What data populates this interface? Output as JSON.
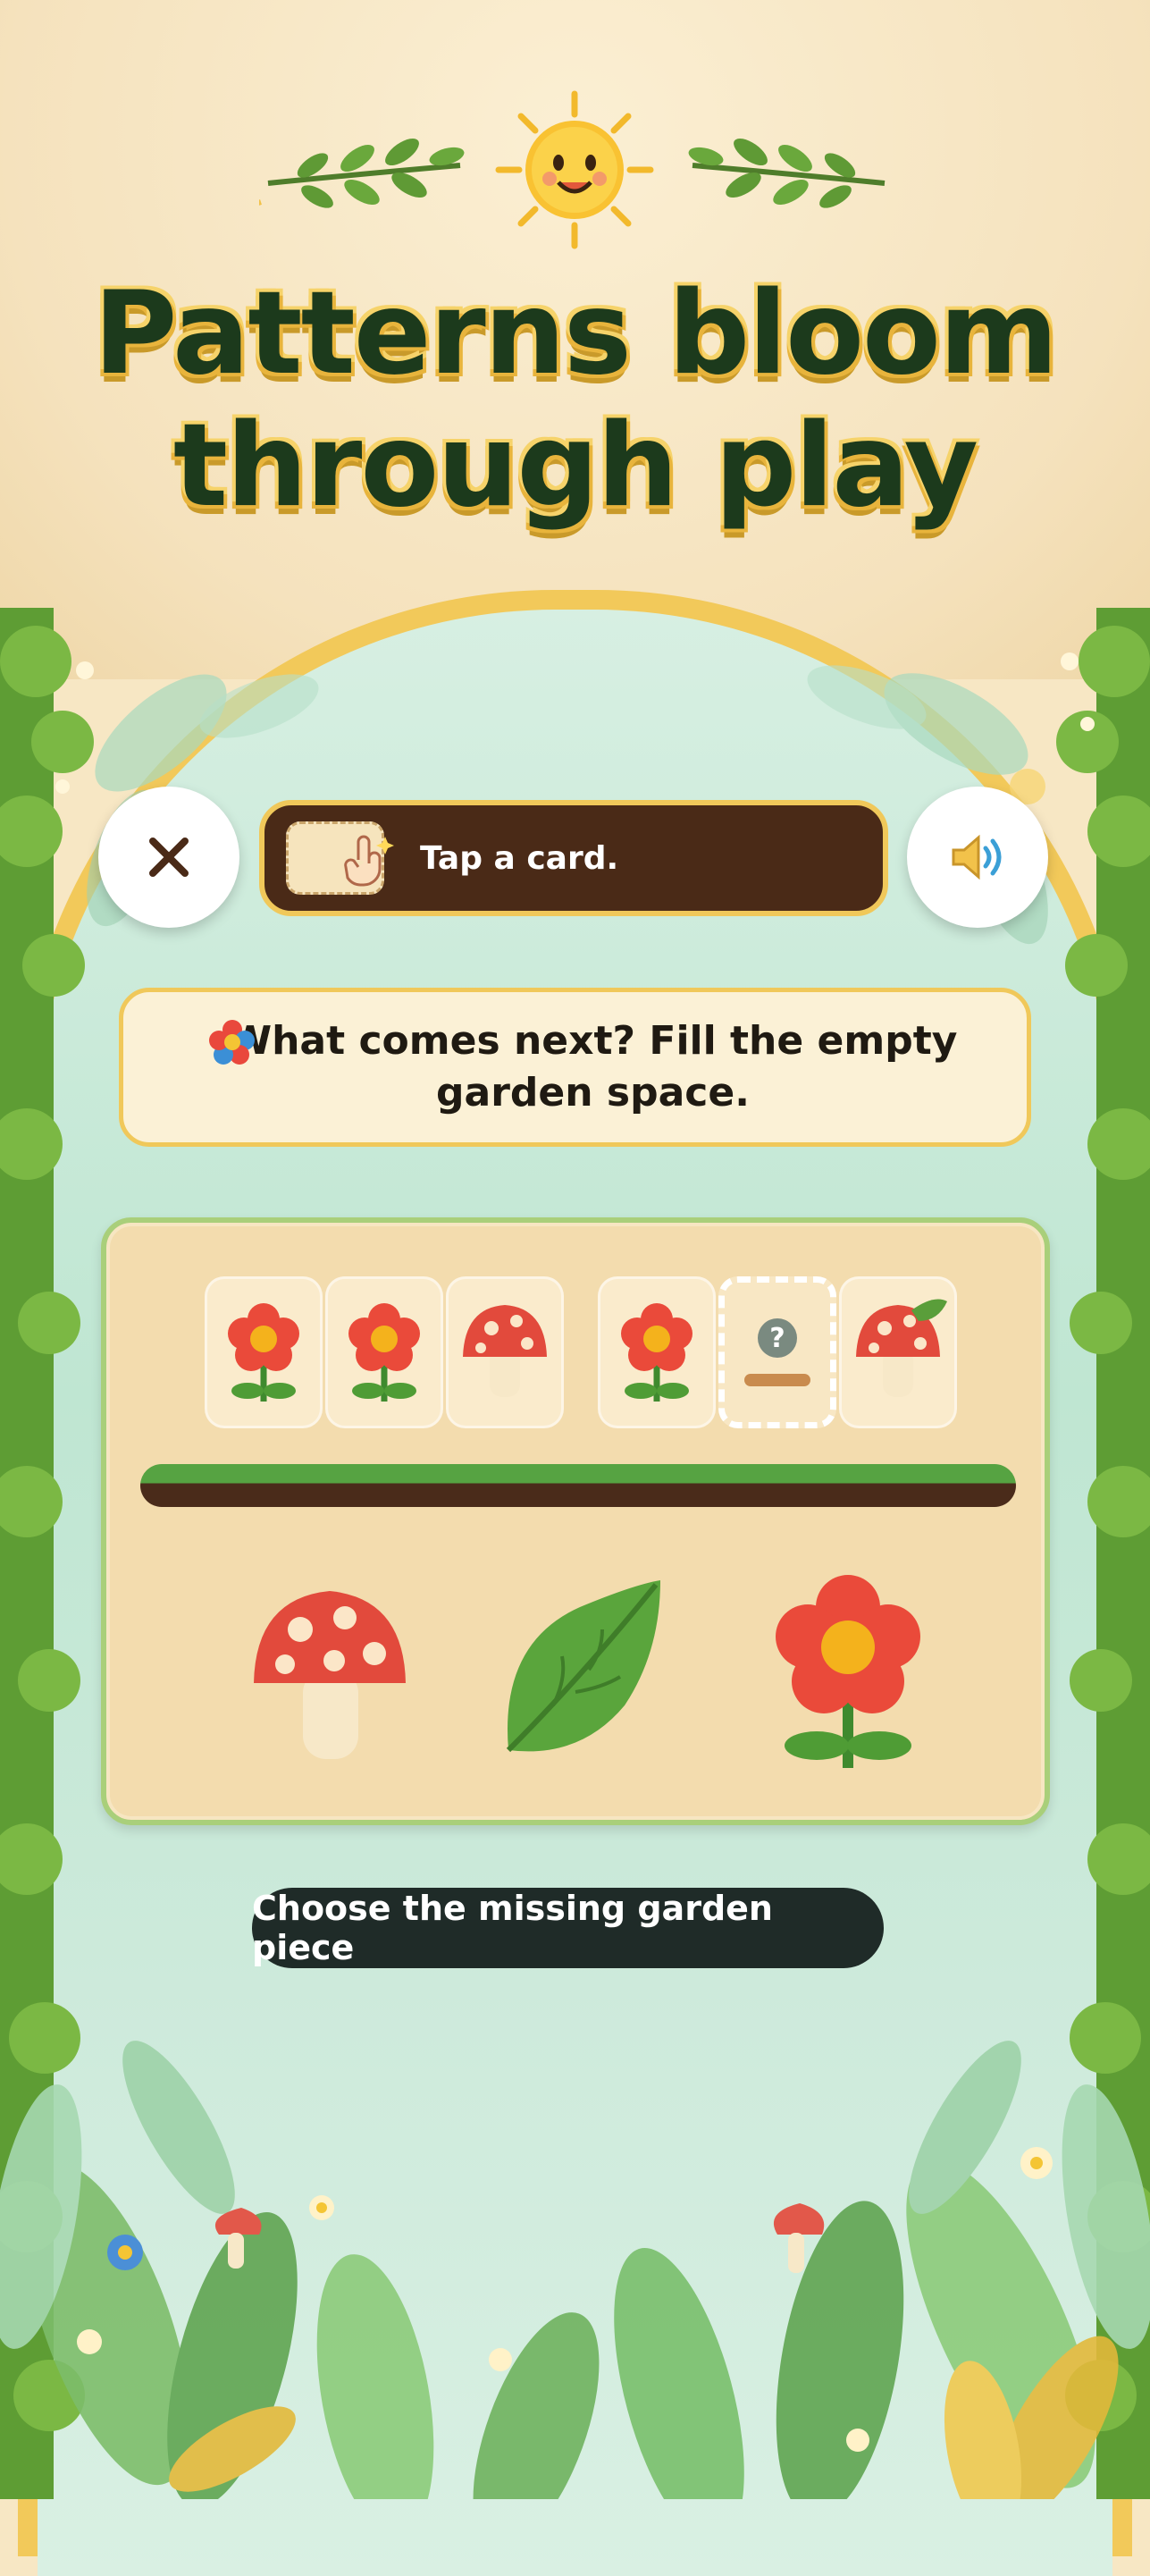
{
  "headline": {
    "line1": "Patterns bloom",
    "line2": "through play"
  },
  "top_bar": {
    "close_icon": "close-x-icon",
    "hint_text": "Tap a card.",
    "hint_icon": "tap-card-icon",
    "sound_icon": "speaker-icon"
  },
  "question": {
    "icon": "flower-icon",
    "text": "What comes next? Fill the empty garden space."
  },
  "pattern": {
    "sequence": [
      "flower",
      "flower",
      "mushroom",
      "flower",
      "empty",
      "mushroom"
    ],
    "empty_symbol": "?"
  },
  "choices": [
    "mushroom",
    "leaf",
    "flower"
  ],
  "instruction": "Choose the missing garden piece",
  "colors": {
    "background": "#f7e7c4",
    "headline": "#1c3a1c",
    "arch_gold": "#f2c95a",
    "mint": "#bfe6d2",
    "pill_dark": "#4a2a17",
    "board": "#f3dcae"
  }
}
